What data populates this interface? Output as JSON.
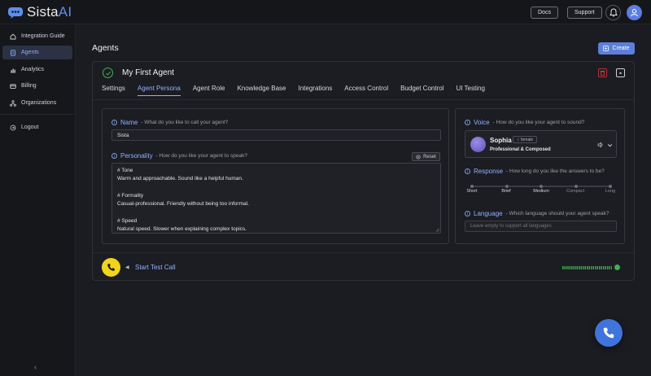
{
  "brand": {
    "name_main": "Sista",
    "name_accent": "AI"
  },
  "header": {
    "docs_label": "Docs",
    "support_label": "Support"
  },
  "sidebar": {
    "items": [
      {
        "label": "Integration Guide",
        "icon": "home-icon"
      },
      {
        "label": "Agents",
        "icon": "file-icon",
        "active": true
      },
      {
        "label": "Analytics",
        "icon": "chart-icon"
      },
      {
        "label": "Billing",
        "icon": "card-icon"
      },
      {
        "label": "Organizations",
        "icon": "org-icon"
      }
    ],
    "logout_label": "Logout",
    "collapse_glyph": "‹"
  },
  "page": {
    "title": "Agents",
    "create_label": "Create"
  },
  "agent": {
    "name_title": "My First Agent",
    "tabs": [
      "Settings",
      "Agent Persona",
      "Agent Role",
      "Knowledge Base",
      "Integrations",
      "Access Control",
      "Budget Control",
      "UI Testing"
    ],
    "active_tab": "Agent Persona"
  },
  "persona": {
    "name_label": "Name",
    "name_help": "- What do you like to call your agent?",
    "name_value": "Sista",
    "personality_label": "Personality",
    "personality_help": "- How do you like your agent to speak?",
    "reset_label": "Reset",
    "personality_lines": [
      "# Tone",
      "Warm and approachable. Sound like a helpful human.",
      "",
      "# Formality",
      "Casual-professional. Friendly without being too informal.",
      "",
      "# Speed",
      "Natural speed. Slower when explaining complex topics."
    ]
  },
  "voice": {
    "label": "Voice",
    "help": "- How do you like your agent to sound?",
    "name": "Sophia",
    "badge": "♀ female",
    "style": "Professional & Composed"
  },
  "response": {
    "label": "Response",
    "help": "- How long do you like the answers to be?",
    "options": [
      "Short",
      "Brief",
      "Medium",
      "Compact",
      "Long"
    ],
    "selected": "Medium"
  },
  "language": {
    "label": "Language",
    "help": "- Which language should your agent speak?",
    "placeholder": "Leave empty to support all languages"
  },
  "test_call": {
    "label": "Start Test Call",
    "arrow_glyph": "◀"
  },
  "colors": {
    "accent": "#8fb0ff",
    "primary_button": "#5c7fd9",
    "call_button": "#f1d41c",
    "status_green": "#3db054",
    "danger": "#b8343a"
  }
}
